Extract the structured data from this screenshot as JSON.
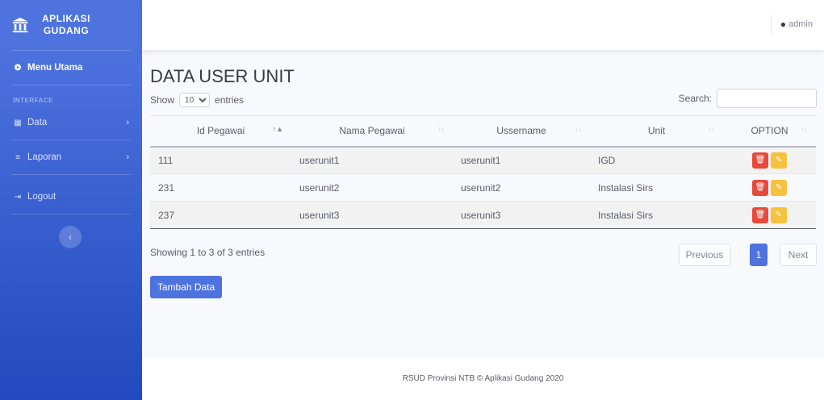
{
  "sidebar": {
    "brand": "APLIKASI GUDANG",
    "brand_line1": "APLIKASI",
    "brand_line2": "GUDANG",
    "menu_utama": "Menu Utama",
    "heading": "INTERFACE",
    "items": [
      {
        "label": "Data",
        "icon": "table-icon"
      },
      {
        "label": "Laporan",
        "icon": "list-icon"
      },
      {
        "label": "Logout",
        "icon": "logout-icon"
      }
    ]
  },
  "topbar": {
    "user": "admin"
  },
  "main": {
    "title": "DATA USER UNIT",
    "show_label": "Show",
    "entries_label": "entries",
    "page_size": "10",
    "search_label": "Search:",
    "search_value": "",
    "columns": [
      "Id Pegawai",
      "Nama Pegawai",
      "Ussername",
      "Unit",
      "OPTION"
    ],
    "rows": [
      {
        "id": "111",
        "nama": "userunit1",
        "username": "userunit1",
        "unit": "IGD"
      },
      {
        "id": "231",
        "nama": "userunit2",
        "username": "userunit2",
        "unit": "Instalasi Sirs"
      },
      {
        "id": "237",
        "nama": "userunit3",
        "username": "userunit3",
        "unit": "Instalasi Sirs"
      }
    ],
    "info": "Showing 1 to 3 of 3 entries",
    "pager": {
      "previous": "Previous",
      "page": "1",
      "next": "Next"
    },
    "add_button": "Tambah Data"
  },
  "footer": "RSUD Provinsi NTB © Aplikasi Gudang 2020",
  "colors": {
    "primary": "#4e73df",
    "danger": "#e74a3b",
    "warning": "#f6c23e"
  }
}
